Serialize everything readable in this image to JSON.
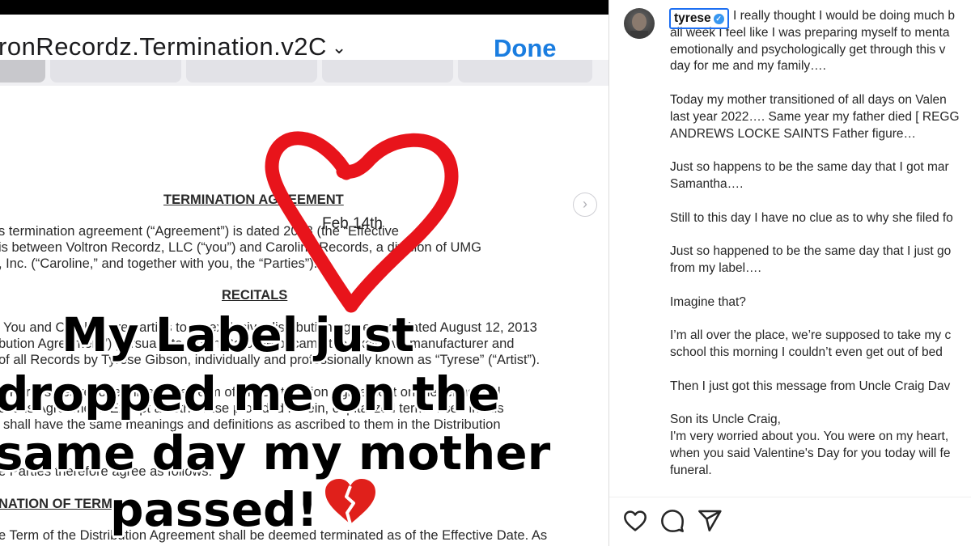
{
  "document_viewer": {
    "file_title": "ronRecordz.Termination.v2C",
    "done_label": "Done",
    "date_annotation": "Feb 14th",
    "lines": {
      "heading_termination": "TERMINATION AGREEMENT",
      "l1": "s termination agreement (“Agreement”) is dated          2023 (the “Effective",
      "l2": "is between Voltron Recordz, LLC (“you”) and Caroline Records, a division of UMG",
      "l3": ", Inc. (“Caroline,” and together with you, the “Parties”).",
      "heading_recitals": "RECITALS",
      "l4": "You and Caroline are parties to an exclusive distribution agreement dated August 12, 2013",
      "l5": "bution Agreement”) pursuant to which Caroline became the exclusive manufacturer and",
      "l6": "of all Records by Tyrese Gibson, individually and professionally known as “Tyrese” (“Artist”).",
      "l7": "e Parties desire to terminate the Term of the Distribution Agreement on the terms and",
      "l8": "of this Agreement. Except as otherwise provided herein, capitalized terms used in this",
      "l9": "shall have the same meanings and definitions as ascribed to them in the Distribution",
      "l10": "e Parties therefore agree as follows:",
      "heading_term": "NATION OF TERM",
      "l11": "e Term of the Distribution Agreement shall be deemed terminated as of the Effective Date.  As"
    },
    "caption_lines": [
      "My Label just",
      "dropped me on the",
      "same day my mother",
      "passed!"
    ],
    "colors": {
      "heart_doodle": "#e8141b",
      "broken_heart": "#e0201b",
      "done": "#1a7de0"
    }
  },
  "post": {
    "username": "tyrese",
    "verified": true,
    "body_lines": [
      "I really thought I would be doing much b",
      "all week I feel like I was preparing myself to menta",
      "emotionally and psychologically get through this v",
      "day for me and my family….",
      "",
      "Today my mother transitioned of all days on Valen",
      "last year 2022…. Same year my father died [ REGG",
      "ANDREWS LOCKE SAINTS Father figure…",
      "",
      "Just so happens to be the same day that I got mar",
      "Samantha….",
      "",
      "Still to this day I have no clue as to why she filed fo",
      "",
      "Just so happened to be the same day that I just go",
      "from my label….",
      "",
      "Imagine that?",
      "",
      "I’m all over the place, we’re supposed to take my c",
      "school this morning I couldn’t even get out of bed",
      "",
      "Then I just got this message from Uncle Craig Dav",
      "",
      "Son its Uncle Craig,",
      "I'm very worried about you. You were on my heart,",
      "when you said Valentine's Day for you today will fe",
      "funeral."
    ],
    "actions": [
      "heart-icon",
      "comment-icon",
      "share-icon"
    ],
    "colors": {
      "verified": "#3897f0",
      "username_highlight": "#1d6ff2"
    }
  }
}
